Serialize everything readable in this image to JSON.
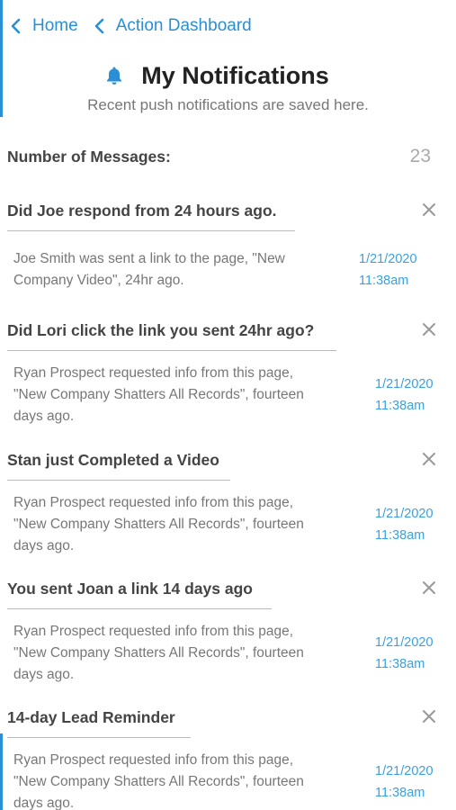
{
  "breadcrumb": [
    {
      "label": "Home"
    },
    {
      "label": "Action Dashboard"
    }
  ],
  "header": {
    "icon": "bell-icon",
    "title": "My Notifications",
    "subtitle": "Recent push notifications are saved here."
  },
  "summary": {
    "label": "Number of Messages:",
    "count": "23"
  },
  "colors": {
    "accent": "#2a8fd6",
    "timestamp": "#3aa0e0",
    "text": "#444444",
    "muted": "#777777"
  },
  "notifications": [
    {
      "title": "Did Joe respond from 24 hours ago.",
      "body": "Joe Smith was sent a link to the page, \"New Company Video\", 24hr ago.",
      "date": "1/21/2020",
      "time": "11:38am"
    },
    {
      "title": "Did Lori click the link you sent 24hr ago?",
      "body": "Ryan Prospect requested info from this page, \"New Company Shatters All Records\", fourteen days ago.",
      "date": "1/21/2020",
      "time": "11:38am"
    },
    {
      "title": "Stan just Completed a Video",
      "body": "Ryan Prospect requested info from this page, \"New Company Shatters All Records\", fourteen days ago.",
      "date": "1/21/2020",
      "time": "11:38am"
    },
    {
      "title": "You sent Joan a link 14 days ago",
      "body": "Ryan Prospect requested info from this page, \"New Company Shatters All Records\", fourteen days ago.",
      "date": "1/21/2020",
      "time": "11:38am"
    },
    {
      "title": "14-day Lead Reminder",
      "body": "Ryan Prospect requested info from this page, \"New Company Shatters All Records\", fourteen days ago.",
      "date": "1/21/2020",
      "time": "11:38am"
    }
  ]
}
